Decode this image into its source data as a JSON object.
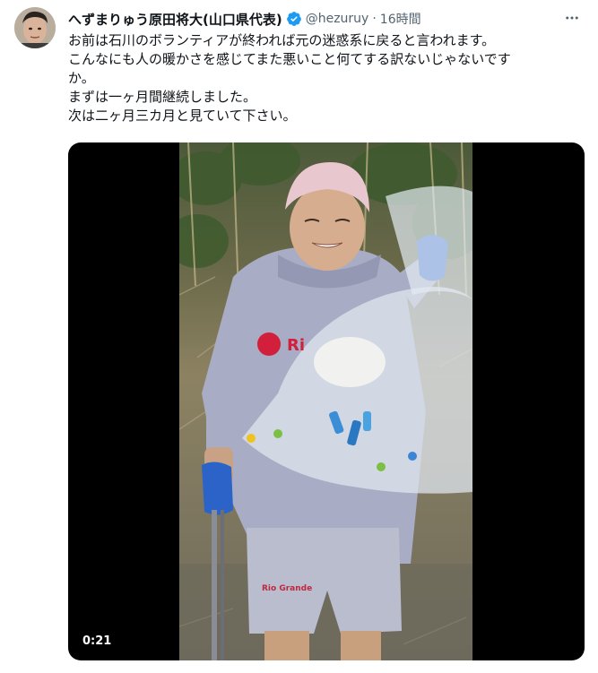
{
  "tweet": {
    "author_name": "へずまりゅう原田将大(山口県代表)",
    "handle": "@hezuruy",
    "separator": "·",
    "time": "16時間",
    "more_icon": "more-horizontal-icon",
    "verified_icon": "verified-badge-icon",
    "verified_color": "#1d9bf0",
    "text_lines": [
      "お前は石川のボランティアが終われば元の迷惑系に戻ると言われます。",
      "こんなにも人の暖かさを感じてまた悪いこと何てする訳ないじゃないです",
      "か。",
      "まずは一ヶ月間継続しました。",
      "次は二ヶ月三カ月と見ていて下さい。"
    ],
    "video": {
      "duration": "0:21",
      "shirt_logo_text": "Ri",
      "shorts_logo_text": "Rio Grande"
    }
  }
}
